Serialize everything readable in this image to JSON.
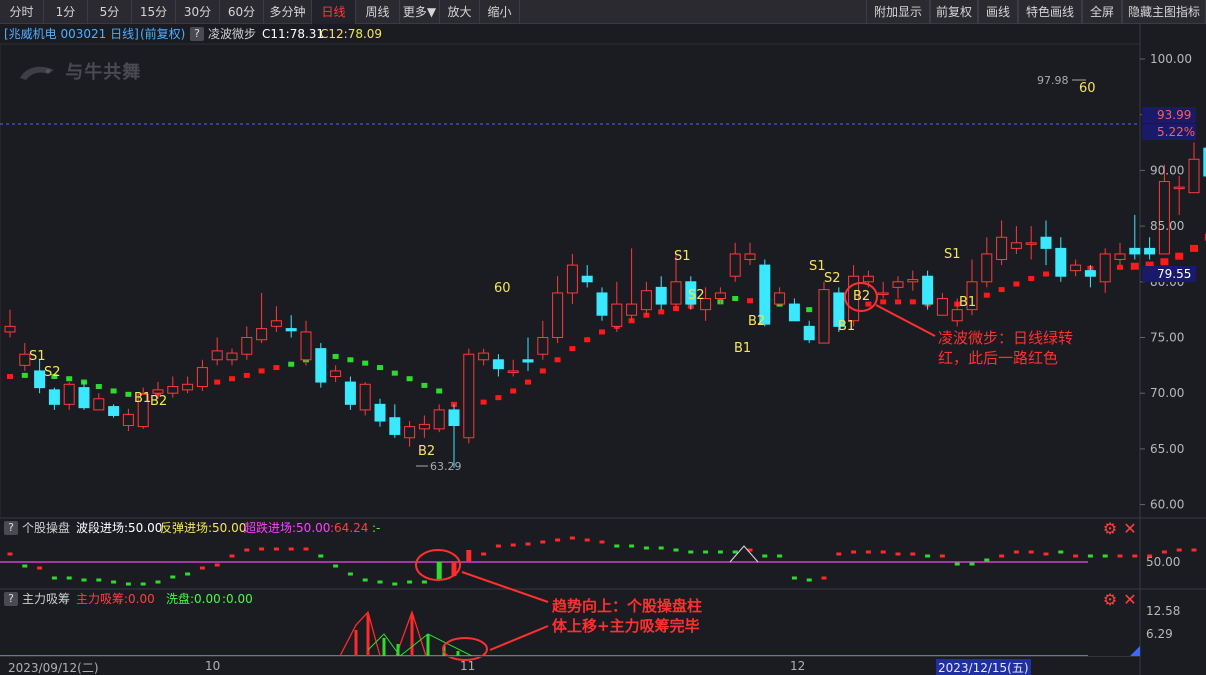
{
  "toolbar": {
    "left_buttons": [
      "分时",
      "1分",
      "5分",
      "15分",
      "30分",
      "60分",
      "多分钟",
      "日线",
      "周线",
      "更多▼",
      "放大",
      "缩小"
    ],
    "active": "日线",
    "right_buttons": [
      "附加显示",
      "前复权",
      "画线",
      "特色画线",
      "全屏",
      "隐藏主图指标"
    ]
  },
  "info": {
    "stock": "[兆威机电 003021 日线]",
    "adjust": "(前复权)",
    "q": "?",
    "indicator": "凌波微步",
    "c11": "C11:78.31",
    "c12": "C12:78.09"
  },
  "watermark": "与牛共舞",
  "price_axis": {
    "ticks": [
      "100.00",
      "95.00",
      "90.00",
      "85.00",
      "80.00",
      "75.00",
      "70.00",
      "65.00",
      "60.00"
    ],
    "current_price": "93.99",
    "current_pct": "5.22%",
    "marker_price": "79.55",
    "colors": {
      "current_bg": "#1a1a6a",
      "current_fg": "#ff5c5c",
      "marker_bg": "#1a1a6a",
      "marker_fg": "#ffffff"
    }
  },
  "main_chart": {
    "max_label": "97.98",
    "min_label": "63.29",
    "max_sub_label": "60",
    "signals": [
      {
        "label": "S1",
        "color": "#f5e65a"
      },
      {
        "label": "S2",
        "color": "#f5e65a"
      },
      {
        "label": "B1",
        "color": "#f5e65a"
      },
      {
        "label": "B2",
        "color": "#f5e65a"
      }
    ],
    "annotation": {
      "text_line1": "凌波微步：日线绿转",
      "text_line2": "红，此后一路红色",
      "color": "#ff3030"
    }
  },
  "panel1": {
    "q": "?",
    "name": "个股操盘",
    "wave": "波段进场:50.00",
    "rebound": "反弹进场:50.00",
    "superfall": "超跌进场:50.00",
    "value": ":64.24",
    "tail": ":-",
    "axis_label": "50.00",
    "colors": {
      "wave": "#ffffff",
      "rebound": "#f5e65a",
      "superfall": "#ff40ff",
      "value": "#ff4040"
    }
  },
  "panel2": {
    "q": "?",
    "name": "主力吸筹",
    "absorb": "主力吸筹:0.00",
    "wash": "洗盘:0.00",
    "zero": ":0.00",
    "axis_high": "12.58",
    "axis_mid": "6.29",
    "annotation": {
      "text_line1": "趋势向上：个股操盘柱",
      "text_line2": "体上移+主力吸筹完毕",
      "color": "#ff3030"
    },
    "colors": {
      "absorb": "#ff4040",
      "wash": "#40ff40",
      "zero": "#40ff40"
    }
  },
  "date_axis": {
    "labels": [
      "2023/09/12(二)",
      "10",
      "11",
      "12",
      "2023/12/15(五)"
    ]
  },
  "icons": {
    "settings": "gear-icon",
    "close": "close-icon"
  }
}
